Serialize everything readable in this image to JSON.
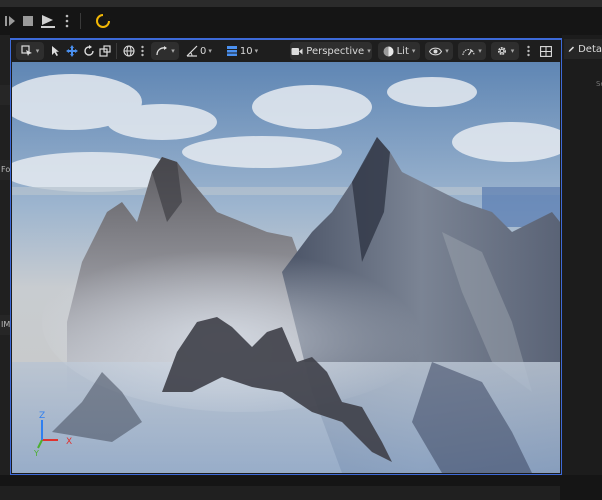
{
  "toolbar": {
    "icons": [
      "skip-frame-icon",
      "stop-icon",
      "play-icon",
      "kebab-menu-icon",
      "compile-status-icon"
    ],
    "status_color": "#f2b705"
  },
  "viewport": {
    "select_mode_icon": "select-mode-icon",
    "angle_snap_value": "0",
    "grid_snap_value": "10",
    "view_mode": "Perspective",
    "lighting_mode": "Lit",
    "border_color": "#3d6ad8"
  },
  "left_panel": {
    "fragments": [
      "Fo",
      "IM"
    ]
  },
  "right_panel": {
    "details_tab_label": "Deta",
    "hint_text": "Se"
  },
  "gizmo": {
    "x_label": "X",
    "y_label": "Y",
    "z_label": "Z",
    "x_color": "#e0322e",
    "y_color": "#4caf2f",
    "z_color": "#2f7ff0"
  }
}
